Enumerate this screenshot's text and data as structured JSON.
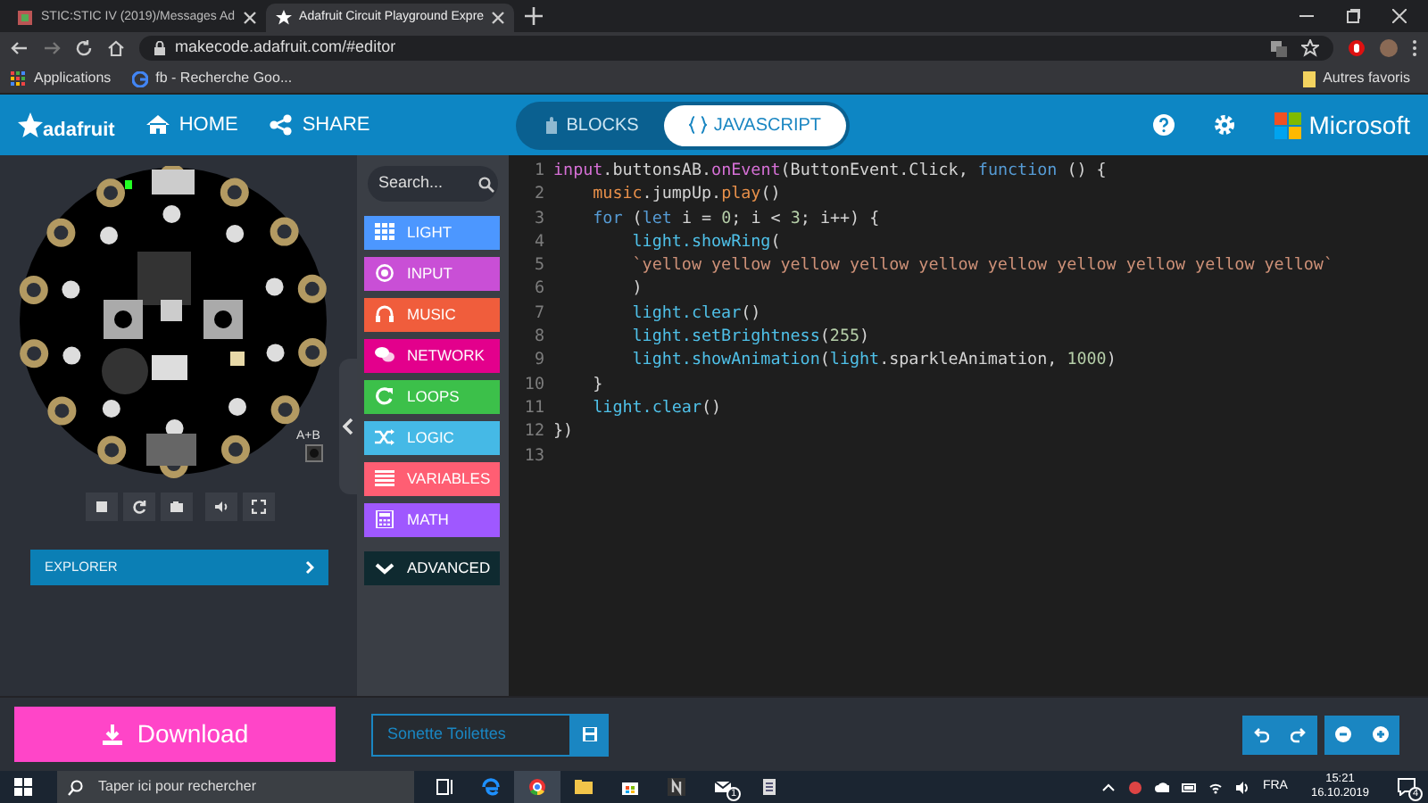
{
  "browser": {
    "tabs": [
      {
        "title": "STIC:STIC IV (2019)/Messages Ad",
        "selected": false
      },
      {
        "title": "Adafruit Circuit Playground Expre",
        "selected": true
      }
    ],
    "address": "makecode.adafruit.com/#editor",
    "bookmarks": [
      "Applications",
      "fb - Recherche Goo..."
    ],
    "other_bookmarks": "Autres favoris"
  },
  "header": {
    "logo": "adafruit",
    "nav": [
      {
        "label": "HOME",
        "kind": "home"
      },
      {
        "label": "SHARE",
        "kind": "share"
      }
    ],
    "modes": [
      {
        "label": "BLOCKS",
        "selected": false
      },
      {
        "label": "JAVASCRIPT",
        "selected": true
      }
    ],
    "brand": "Microsoft"
  },
  "simulator": {
    "button_label": "A+B",
    "explorer": "EXPLORER"
  },
  "toolbox": {
    "search_placeholder": "Search...",
    "categories": [
      {
        "label": "LIGHT",
        "color": "#4c97ff",
        "kind": "grid"
      },
      {
        "label": "INPUT",
        "color": "#c94fd6",
        "kind": "target"
      },
      {
        "label": "MUSIC",
        "color": "#f05d3c",
        "kind": "headphones"
      },
      {
        "label": "NETWORK",
        "color": "#e3008c",
        "kind": "chat"
      },
      {
        "label": "LOOPS",
        "color": "#3cc04a",
        "kind": "loop"
      },
      {
        "label": "LOGIC",
        "color": "#45b9e6",
        "kind": "shuffle"
      },
      {
        "label": "VARIABLES",
        "color": "#ff5e73",
        "kind": "lines"
      },
      {
        "label": "MATH",
        "color": "#9f58ff",
        "kind": "calculator"
      }
    ],
    "advanced": "ADVANCED"
  },
  "editor": {
    "lines": [
      {
        "number": "1",
        "tokens": [
          {
            "text": "input",
            "color": "#d670d6"
          },
          {
            "text": ".buttonsAB.",
            "color": "#d4d4d4"
          },
          {
            "text": "onEvent",
            "color": "#d670d6"
          },
          {
            "text": "(ButtonEvent.Click, ",
            "color": "#d4d4d4"
          },
          {
            "text": "function",
            "color": "#569cd6"
          },
          {
            "text": " () {",
            "color": "#d4d4d4"
          }
        ]
      },
      {
        "number": "2",
        "tokens": [
          {
            "text": "    music",
            "color": "#e8904a"
          },
          {
            "text": ".jumpUp.",
            "color": "#d4d4d4"
          },
          {
            "text": "play",
            "color": "#e8904a"
          },
          {
            "text": "()",
            "color": "#d4d4d4"
          }
        ]
      },
      {
        "number": "3",
        "tokens": [
          {
            "text": "    for",
            "color": "#569cd6"
          },
          {
            "text": " (",
            "color": "#d4d4d4"
          },
          {
            "text": "let",
            "color": "#569cd6"
          },
          {
            "text": " i = ",
            "color": "#d4d4d4"
          },
          {
            "text": "0",
            "color": "#b5cea8"
          },
          {
            "text": "; i < ",
            "color": "#d4d4d4"
          },
          {
            "text": "3",
            "color": "#b5cea8"
          },
          {
            "text": "; i++) {",
            "color": "#d4d4d4"
          }
        ]
      },
      {
        "number": "4",
        "tokens": [
          {
            "text": "        light.showRing",
            "color": "#4fc1e9"
          },
          {
            "text": "(",
            "color": "#d4d4d4"
          }
        ]
      },
      {
        "number": "5",
        "tokens": [
          {
            "text": "        `yellow yellow yellow yellow yellow yellow yellow yellow yellow yellow`",
            "color": "#ce9178"
          }
        ]
      },
      {
        "number": "6",
        "tokens": [
          {
            "text": "        )",
            "color": "#d4d4d4"
          }
        ]
      },
      {
        "number": "7",
        "tokens": [
          {
            "text": "        light.clear",
            "color": "#4fc1e9"
          },
          {
            "text": "()",
            "color": "#d4d4d4"
          }
        ]
      },
      {
        "number": "8",
        "tokens": [
          {
            "text": "        light.setBrightness",
            "color": "#4fc1e9"
          },
          {
            "text": "(",
            "color": "#d4d4d4"
          },
          {
            "text": "255",
            "color": "#b5cea8"
          },
          {
            "text": ")",
            "color": "#d4d4d4"
          }
        ]
      },
      {
        "number": "9",
        "tokens": [
          {
            "text": "        light.showAnimation",
            "color": "#4fc1e9"
          },
          {
            "text": "(",
            "color": "#d4d4d4"
          },
          {
            "text": "light",
            "color": "#4fc1e9"
          },
          {
            "text": ".sparkleAnimation, ",
            "color": "#d4d4d4"
          },
          {
            "text": "1000",
            "color": "#b5cea8"
          },
          {
            "text": ")",
            "color": "#d4d4d4"
          }
        ]
      },
      {
        "number": "10",
        "tokens": [
          {
            "text": "    }",
            "color": "#d4d4d4"
          }
        ]
      },
      {
        "number": "11",
        "tokens": [
          {
            "text": "    light.clear",
            "color": "#4fc1e9"
          },
          {
            "text": "()",
            "color": "#d4d4d4"
          }
        ]
      },
      {
        "number": "12",
        "tokens": [
          {
            "text": "})",
            "color": "#d4d4d4"
          }
        ]
      },
      {
        "number": "13"
      }
    ]
  },
  "bottom": {
    "download": "Download",
    "project_name": "Sonette Toilettes"
  },
  "taskbar": {
    "search_placeholder": "Taper ici pour rechercher",
    "mail_badge": "1",
    "language": "FRA",
    "time": "15:21",
    "date": "16.10.2019",
    "notification_count": "4"
  }
}
